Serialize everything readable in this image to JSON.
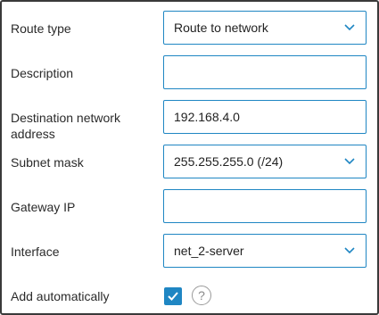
{
  "form": {
    "route_type": {
      "label": "Route type",
      "value": "Route to network"
    },
    "description": {
      "label": "Description",
      "value": ""
    },
    "destination": {
      "label_line1": "Destination network",
      "label_line2": "address",
      "value": "192.168.4.0"
    },
    "subnet_mask": {
      "label": "Subnet mask",
      "value": "255.255.255.0 (/24)"
    },
    "gateway_ip": {
      "label": "Gateway IP",
      "value": ""
    },
    "interface": {
      "label": "Interface",
      "value": "net_2-server"
    },
    "add_automatically": {
      "label": "Add automatically",
      "checked": true,
      "help_glyph": "?"
    }
  },
  "colors": {
    "accent": "#1f86c3",
    "border": "#3a3a3a"
  },
  "icons": {
    "dropdown": "chevron-down-icon",
    "check": "checkmark-icon",
    "help": "help-icon"
  }
}
